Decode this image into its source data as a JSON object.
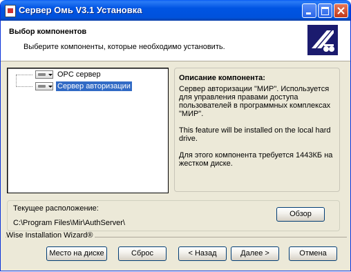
{
  "window": {
    "title": "Сервер Омь V3.1 Установка"
  },
  "header": {
    "title": "Выбор компонентов",
    "subtitle": "Выберите компоненты, которые необходимо установить."
  },
  "tree": {
    "items": [
      {
        "label": "OPC сервер",
        "selected": false
      },
      {
        "label": "Сервер авторизации",
        "selected": true
      }
    ]
  },
  "description": {
    "title": "Описание компонента:",
    "text": "Сервер авторизации \"МИР\". Используется для управления правами доступа пользователей в программных комплексах \"МИР\".",
    "install_note": "This feature will be installed on the local hard drive.",
    "space_note": "Для этого компонента требуется 1443КБ на жестком диске."
  },
  "location": {
    "label": "Текущее расположение:",
    "path": "C:\\Program Files\\Mir\\AuthServer\\",
    "browse_label": "Обзор"
  },
  "footer": {
    "brand": "Wise Installation Wizard®",
    "disk_usage_label": "Место на диске",
    "reset_label": "Сброс",
    "back_label": "< Назад",
    "next_label": "Далее >",
    "cancel_label": "Отмена"
  },
  "colors": {
    "titlebar": "#0054e3",
    "selection": "#316ac5",
    "logo": "#1b1b6e",
    "dialog_bg": "#ece9d8"
  }
}
